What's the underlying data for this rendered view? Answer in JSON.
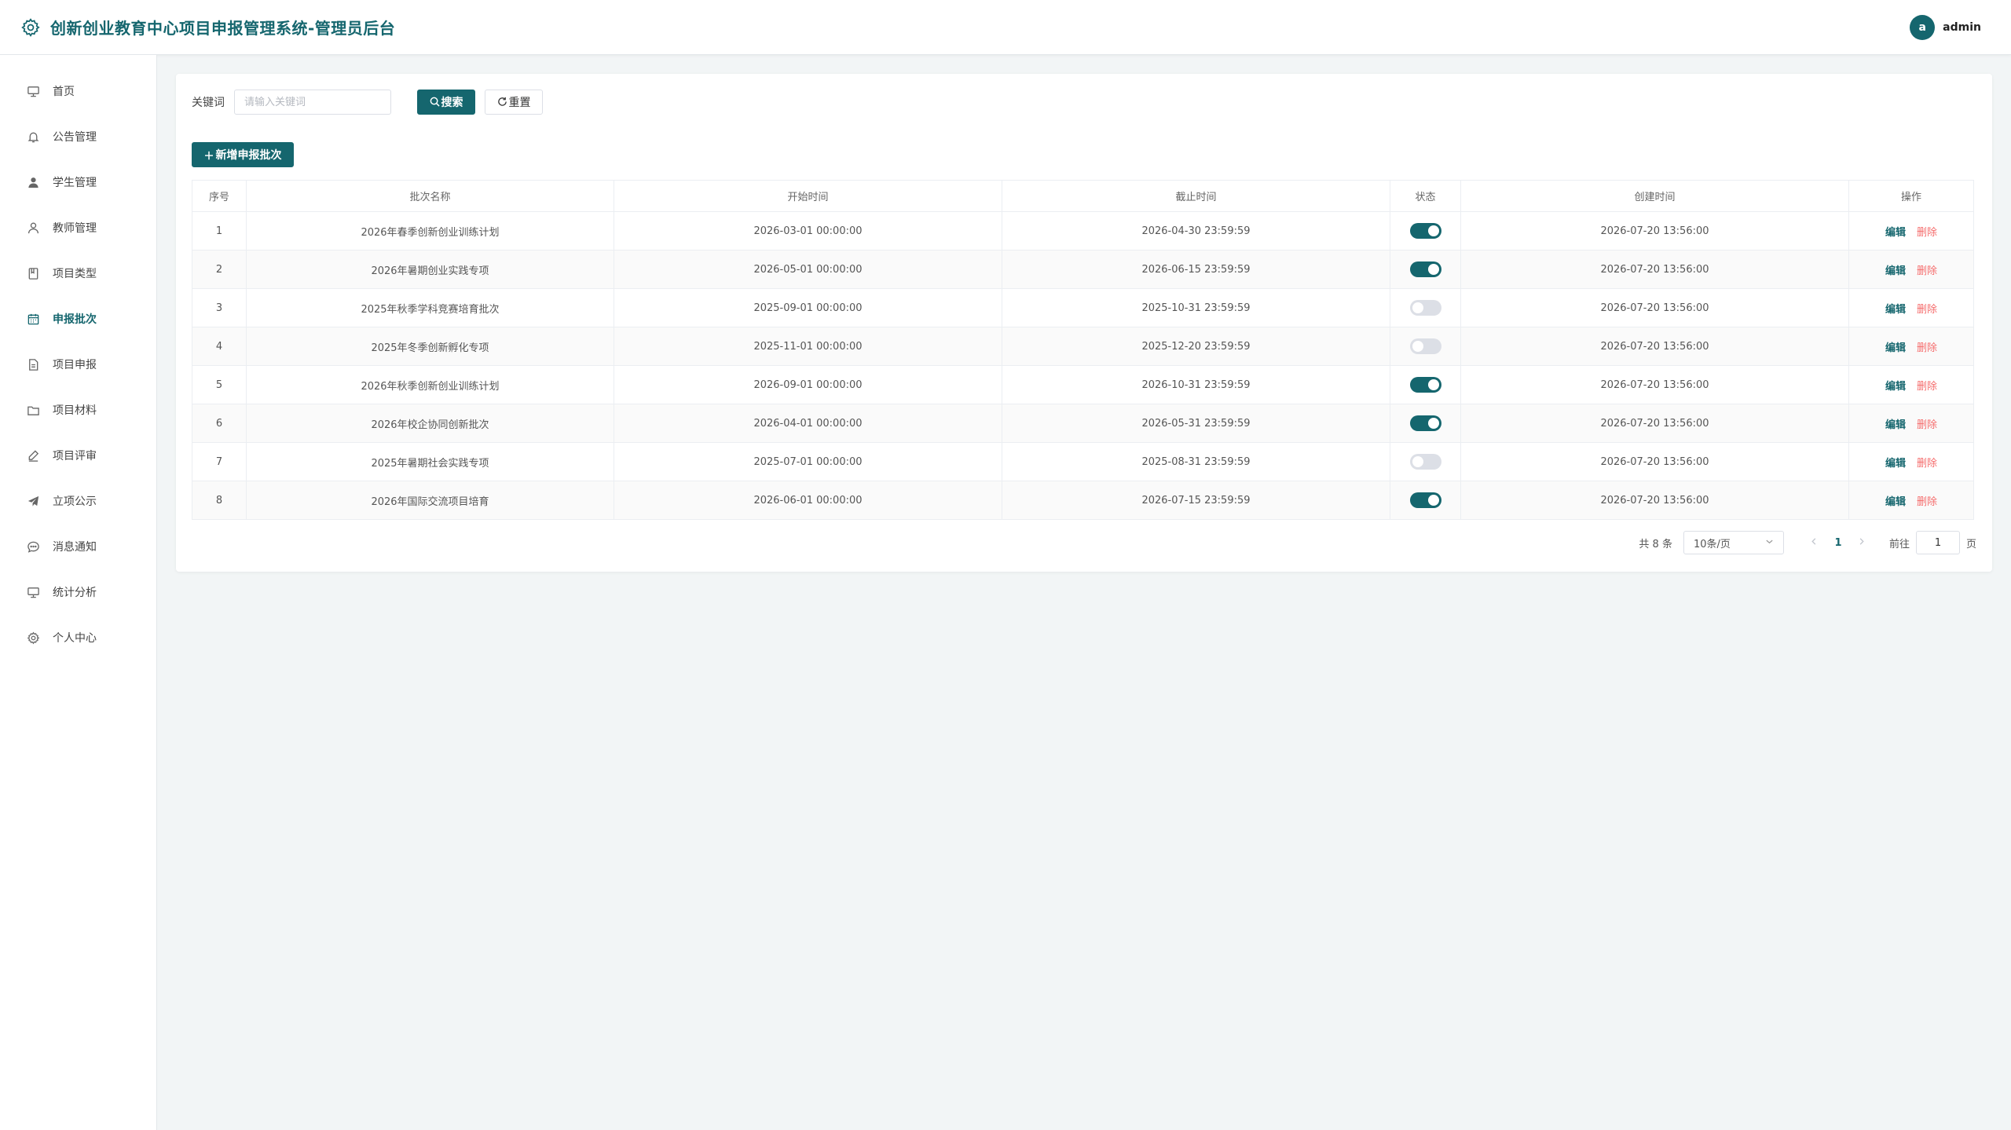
{
  "header": {
    "title": "创新创业教育中心项目申报管理系统-管理员后台",
    "avatar_letter": "a",
    "username": "admin"
  },
  "sidebar": {
    "items": [
      {
        "label": "首页",
        "icon": "monitor-icon",
        "active": false
      },
      {
        "label": "公告管理",
        "icon": "bell-icon",
        "active": false
      },
      {
        "label": "学生管理",
        "icon": "user-filled-icon",
        "active": false
      },
      {
        "label": "教师管理",
        "icon": "user-icon",
        "active": false
      },
      {
        "label": "项目类型",
        "icon": "notebook-icon",
        "active": false
      },
      {
        "label": "申报批次",
        "icon": "calendar-icon",
        "active": true
      },
      {
        "label": "项目申报",
        "icon": "document-icon",
        "active": false
      },
      {
        "label": "项目材料",
        "icon": "folder-icon",
        "active": false
      },
      {
        "label": "项目评审",
        "icon": "edit-pen-icon",
        "active": false
      },
      {
        "label": "立项公示",
        "icon": "promotion-icon",
        "active": false
      },
      {
        "label": "消息通知",
        "icon": "chat-icon",
        "active": false
      },
      {
        "label": "统计分析",
        "icon": "monitor-icon",
        "active": false
      },
      {
        "label": "个人中心",
        "icon": "setting-icon",
        "active": false
      }
    ]
  },
  "search": {
    "label": "关键词",
    "placeholder": "请输入关键词",
    "value": "",
    "search_label": "搜索",
    "reset_label": "重置"
  },
  "toolbar": {
    "add_label": "新增申报批次"
  },
  "table": {
    "columns": [
      "序号",
      "批次名称",
      "开始时间",
      "截止时间",
      "状态",
      "创建时间",
      "操作"
    ],
    "edit_label": "编辑",
    "delete_label": "删除",
    "rows": [
      {
        "index": "1",
        "name": "2026年春季创新创业训练计划",
        "start": "2026-03-01 00:00:00",
        "end": "2026-04-30 23:59:59",
        "status": true,
        "created": "2026-07-20 13:56:00"
      },
      {
        "index": "2",
        "name": "2026年暑期创业实践专项",
        "start": "2026-05-01 00:00:00",
        "end": "2026-06-15 23:59:59",
        "status": true,
        "created": "2026-07-20 13:56:00"
      },
      {
        "index": "3",
        "name": "2025年秋季学科竞赛培育批次",
        "start": "2025-09-01 00:00:00",
        "end": "2025-10-31 23:59:59",
        "status": false,
        "created": "2026-07-20 13:56:00"
      },
      {
        "index": "4",
        "name": "2025年冬季创新孵化专项",
        "start": "2025-11-01 00:00:00",
        "end": "2025-12-20 23:59:59",
        "status": false,
        "created": "2026-07-20 13:56:00"
      },
      {
        "index": "5",
        "name": "2026年秋季创新创业训练计划",
        "start": "2026-09-01 00:00:00",
        "end": "2026-10-31 23:59:59",
        "status": true,
        "created": "2026-07-20 13:56:00"
      },
      {
        "index": "6",
        "name": "2026年校企协同创新批次",
        "start": "2026-04-01 00:00:00",
        "end": "2026-05-31 23:59:59",
        "status": true,
        "created": "2026-07-20 13:56:00"
      },
      {
        "index": "7",
        "name": "2025年暑期社会实践专项",
        "start": "2025-07-01 00:00:00",
        "end": "2025-08-31 23:59:59",
        "status": false,
        "created": "2026-07-20 13:56:00"
      },
      {
        "index": "8",
        "name": "2026年国际交流项目培育",
        "start": "2026-06-01 00:00:00",
        "end": "2026-07-15 23:59:59",
        "status": true,
        "created": "2026-07-20 13:56:00"
      }
    ]
  },
  "pagination": {
    "total_text": "共 8 条",
    "page_size": "10条/页",
    "current_page": "1",
    "goto_label": "前往",
    "goto_value": "1",
    "page_suffix": "页"
  },
  "colors": {
    "primary": "#15666e",
    "danger": "#f56c6c",
    "background": "#f2f5f6"
  }
}
